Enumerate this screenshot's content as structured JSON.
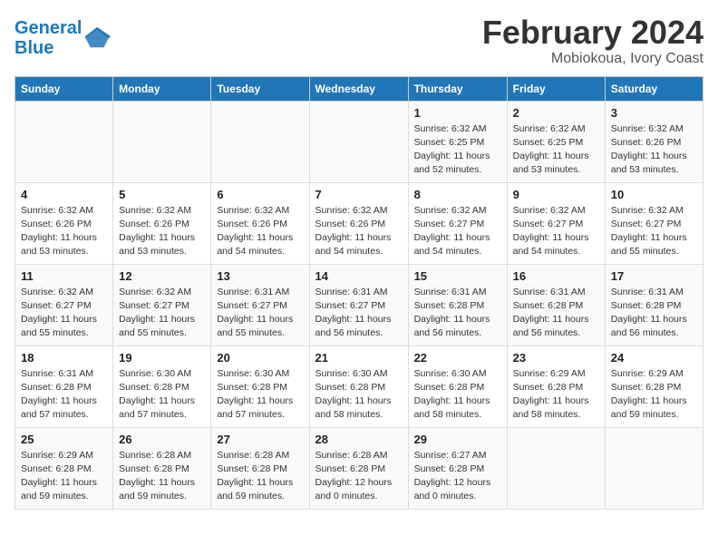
{
  "header": {
    "logo_line1": "General",
    "logo_line2": "Blue",
    "title": "February 2024",
    "subtitle": "Mobiokoua, Ivory Coast"
  },
  "calendar": {
    "days_of_week": [
      "Sunday",
      "Monday",
      "Tuesday",
      "Wednesday",
      "Thursday",
      "Friday",
      "Saturday"
    ],
    "weeks": [
      [
        {
          "day": "",
          "details": ""
        },
        {
          "day": "",
          "details": ""
        },
        {
          "day": "",
          "details": ""
        },
        {
          "day": "",
          "details": ""
        },
        {
          "day": "1",
          "details": "Sunrise: 6:32 AM\nSunset: 6:25 PM\nDaylight: 11 hours\nand 52 minutes."
        },
        {
          "day": "2",
          "details": "Sunrise: 6:32 AM\nSunset: 6:25 PM\nDaylight: 11 hours\nand 53 minutes."
        },
        {
          "day": "3",
          "details": "Sunrise: 6:32 AM\nSunset: 6:26 PM\nDaylight: 11 hours\nand 53 minutes."
        }
      ],
      [
        {
          "day": "4",
          "details": "Sunrise: 6:32 AM\nSunset: 6:26 PM\nDaylight: 11 hours\nand 53 minutes."
        },
        {
          "day": "5",
          "details": "Sunrise: 6:32 AM\nSunset: 6:26 PM\nDaylight: 11 hours\nand 53 minutes."
        },
        {
          "day": "6",
          "details": "Sunrise: 6:32 AM\nSunset: 6:26 PM\nDaylight: 11 hours\nand 54 minutes."
        },
        {
          "day": "7",
          "details": "Sunrise: 6:32 AM\nSunset: 6:26 PM\nDaylight: 11 hours\nand 54 minutes."
        },
        {
          "day": "8",
          "details": "Sunrise: 6:32 AM\nSunset: 6:27 PM\nDaylight: 11 hours\nand 54 minutes."
        },
        {
          "day": "9",
          "details": "Sunrise: 6:32 AM\nSunset: 6:27 PM\nDaylight: 11 hours\nand 54 minutes."
        },
        {
          "day": "10",
          "details": "Sunrise: 6:32 AM\nSunset: 6:27 PM\nDaylight: 11 hours\nand 55 minutes."
        }
      ],
      [
        {
          "day": "11",
          "details": "Sunrise: 6:32 AM\nSunset: 6:27 PM\nDaylight: 11 hours\nand 55 minutes."
        },
        {
          "day": "12",
          "details": "Sunrise: 6:32 AM\nSunset: 6:27 PM\nDaylight: 11 hours\nand 55 minutes."
        },
        {
          "day": "13",
          "details": "Sunrise: 6:31 AM\nSunset: 6:27 PM\nDaylight: 11 hours\nand 55 minutes."
        },
        {
          "day": "14",
          "details": "Sunrise: 6:31 AM\nSunset: 6:27 PM\nDaylight: 11 hours\nand 56 minutes."
        },
        {
          "day": "15",
          "details": "Sunrise: 6:31 AM\nSunset: 6:28 PM\nDaylight: 11 hours\nand 56 minutes."
        },
        {
          "day": "16",
          "details": "Sunrise: 6:31 AM\nSunset: 6:28 PM\nDaylight: 11 hours\nand 56 minutes."
        },
        {
          "day": "17",
          "details": "Sunrise: 6:31 AM\nSunset: 6:28 PM\nDaylight: 11 hours\nand 56 minutes."
        }
      ],
      [
        {
          "day": "18",
          "details": "Sunrise: 6:31 AM\nSunset: 6:28 PM\nDaylight: 11 hours\nand 57 minutes."
        },
        {
          "day": "19",
          "details": "Sunrise: 6:30 AM\nSunset: 6:28 PM\nDaylight: 11 hours\nand 57 minutes."
        },
        {
          "day": "20",
          "details": "Sunrise: 6:30 AM\nSunset: 6:28 PM\nDaylight: 11 hours\nand 57 minutes."
        },
        {
          "day": "21",
          "details": "Sunrise: 6:30 AM\nSunset: 6:28 PM\nDaylight: 11 hours\nand 58 minutes."
        },
        {
          "day": "22",
          "details": "Sunrise: 6:30 AM\nSunset: 6:28 PM\nDaylight: 11 hours\nand 58 minutes."
        },
        {
          "day": "23",
          "details": "Sunrise: 6:29 AM\nSunset: 6:28 PM\nDaylight: 11 hours\nand 58 minutes."
        },
        {
          "day": "24",
          "details": "Sunrise: 6:29 AM\nSunset: 6:28 PM\nDaylight: 11 hours\nand 59 minutes."
        }
      ],
      [
        {
          "day": "25",
          "details": "Sunrise: 6:29 AM\nSunset: 6:28 PM\nDaylight: 11 hours\nand 59 minutes."
        },
        {
          "day": "26",
          "details": "Sunrise: 6:28 AM\nSunset: 6:28 PM\nDaylight: 11 hours\nand 59 minutes."
        },
        {
          "day": "27",
          "details": "Sunrise: 6:28 AM\nSunset: 6:28 PM\nDaylight: 11 hours\nand 59 minutes."
        },
        {
          "day": "28",
          "details": "Sunrise: 6:28 AM\nSunset: 6:28 PM\nDaylight: 12 hours\nand 0 minutes."
        },
        {
          "day": "29",
          "details": "Sunrise: 6:27 AM\nSunset: 6:28 PM\nDaylight: 12 hours\nand 0 minutes."
        },
        {
          "day": "",
          "details": ""
        },
        {
          "day": "",
          "details": ""
        }
      ]
    ]
  }
}
